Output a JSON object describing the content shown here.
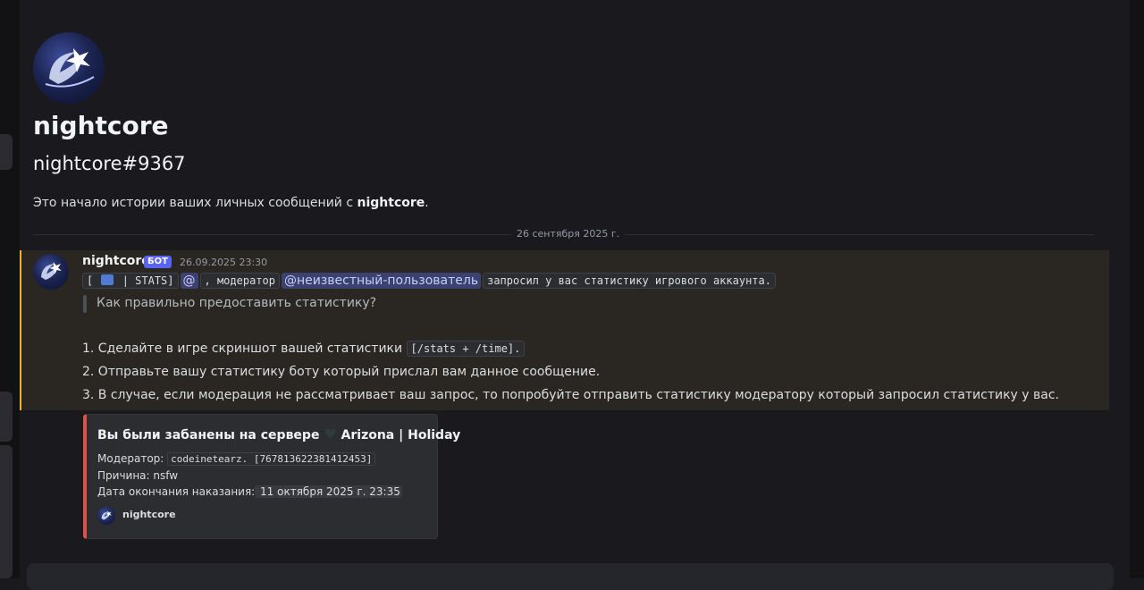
{
  "profile": {
    "name": "nightcore",
    "tag": "nightcore#9367",
    "intro_prefix": "Это начало истории ваших личных сообщений с ",
    "intro_name": "nightcore",
    "intro_suffix": "."
  },
  "divider": {
    "date": "26 сентября 2025 г."
  },
  "message": {
    "author": "nightcore",
    "badge": "БОТ",
    "timestamp": "26.09.2025 23:30",
    "line1": {
      "code_open": "[",
      "code_stats": " | STATS]",
      "at": "@",
      "code_moderator": ", модератор",
      "mention": "@неизвестный-пользователь",
      "code_rest": " запросил у вас статистику игрового аккаунта."
    },
    "quote": "Как правильно предоставить статистику?",
    "steps": [
      {
        "text": "1. Сделайте в игре скриншот вашей статистики ",
        "code": "[/stats + /time]."
      },
      {
        "text": "2. Отправьте вашу статистику боту который прислал вам данное сообщение."
      },
      {
        "text": "3. В случае, если модерация не рассматривает ваш запрос, то попробуйте отправить статистику модератору который запросил статистику у вас."
      }
    ]
  },
  "embed": {
    "title_prefix": "Вы были забанены на сервере ",
    "heart": "♥",
    "title_server": " Arizona | Holiday",
    "moderator_label": "Модератор: ",
    "moderator_value": "codeinetearz. [767813622381412453]",
    "reason": "Причина: nsfw",
    "end_label": "Дата окончания наказания:",
    "end_value": " 11 октября 2025 г. 23:35",
    "footer_name": "nightcore",
    "accent_color": "#e0514a"
  },
  "colors": {
    "background": "#1a1a1e",
    "highlight": "#2a2722",
    "highlight_border": "#f0b232",
    "bot_badge": "#5865f2",
    "mention": "#3c4270"
  }
}
